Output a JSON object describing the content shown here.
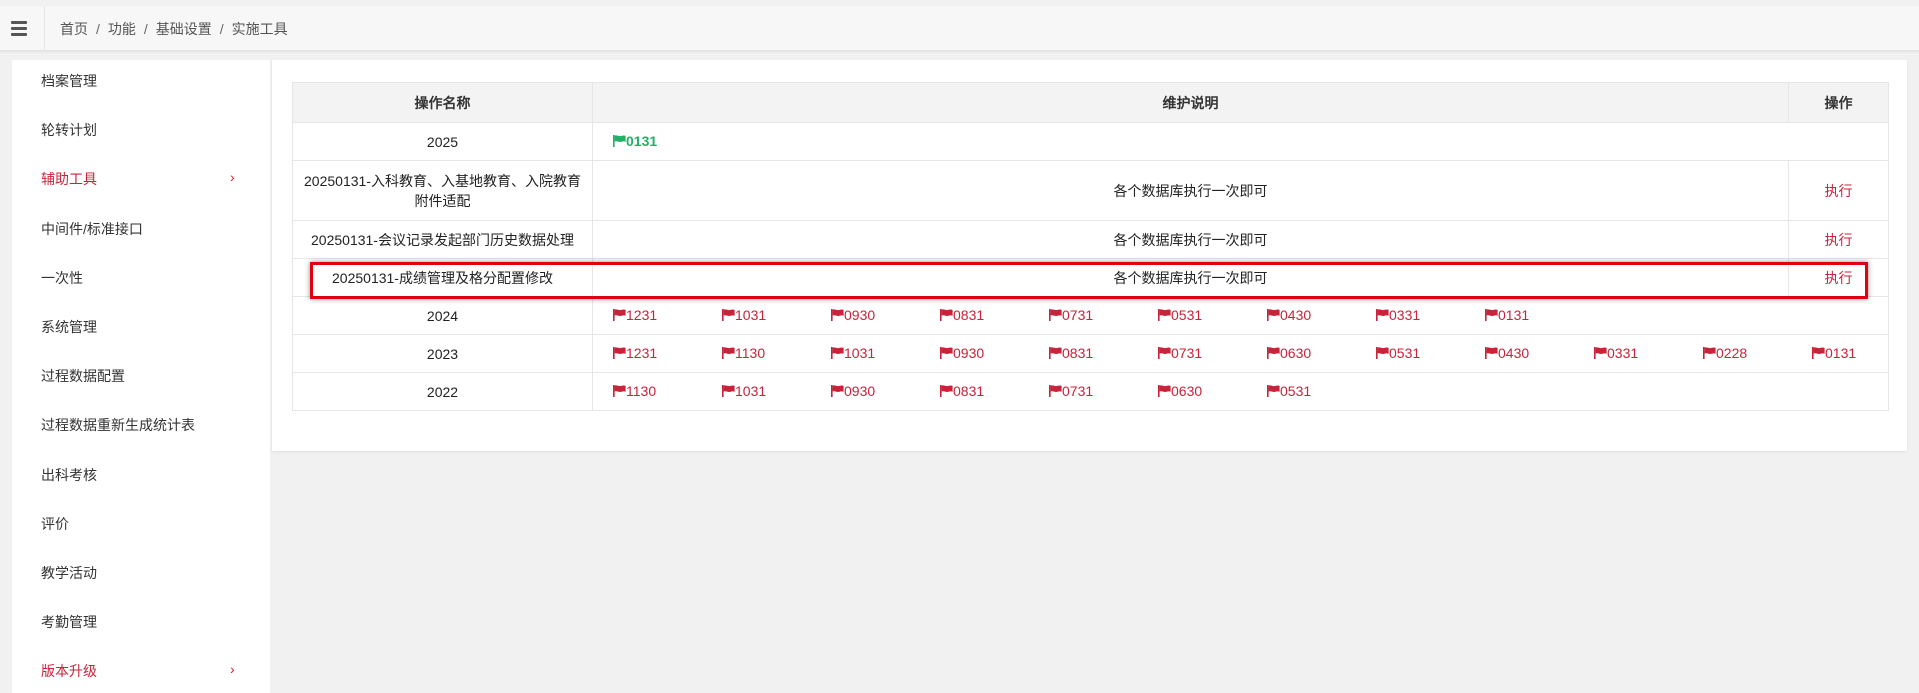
{
  "breadcrumb": [
    {
      "label": "首页",
      "name": "breadcrumb-home"
    },
    {
      "label": "功能",
      "name": "breadcrumb-function"
    },
    {
      "label": "基础设置",
      "name": "breadcrumb-basic-settings"
    },
    {
      "label": "实施工具",
      "name": "breadcrumb-implementation-tools"
    }
  ],
  "sidebar": {
    "items": [
      {
        "label": "档案管理",
        "active": false,
        "expandable": false
      },
      {
        "label": "轮转计划",
        "active": false,
        "expandable": false
      },
      {
        "label": "辅助工具",
        "active": true,
        "expandable": true
      },
      {
        "label": "中间件/标准接口",
        "active": false,
        "expandable": false
      },
      {
        "label": "一次性",
        "active": false,
        "expandable": false
      },
      {
        "label": "系统管理",
        "active": false,
        "expandable": false
      },
      {
        "label": "过程数据配置",
        "active": false,
        "expandable": false
      },
      {
        "label": "过程数据重新生成统计表",
        "active": false,
        "expandable": false
      },
      {
        "label": "出科考核",
        "active": false,
        "expandable": false
      },
      {
        "label": "评价",
        "active": false,
        "expandable": false
      },
      {
        "label": "教学活动",
        "active": false,
        "expandable": false
      },
      {
        "label": "考勤管理",
        "active": false,
        "expandable": false
      },
      {
        "label": "版本升级",
        "active": true,
        "expandable": true
      }
    ],
    "chevron": "›"
  },
  "table": {
    "headers": {
      "name": "操作名称",
      "desc": "维护说明",
      "op": "操作"
    },
    "rows": [
      {
        "type": "year",
        "name": "2025",
        "flags": [
          "0131"
        ],
        "flag_color": "#21b066"
      },
      {
        "type": "op",
        "name_line1": "20250131-入科教育、入基地教育、入院教育",
        "name_line2": "附件适配",
        "desc": "各个数据库执行一次即可",
        "op": "执行"
      },
      {
        "type": "op",
        "name": "20250131-会议记录发起部门历史数据处理",
        "desc": "各个数据库执行一次即可",
        "op": "执行"
      },
      {
        "type": "op",
        "name": "20250131-成绩管理及格分配置修改",
        "desc": "各个数据库执行一次即可",
        "op": "执行"
      },
      {
        "type": "year",
        "name": "2024",
        "flags": [
          "1231",
          "1031",
          "0930",
          "0831",
          "0731",
          "0531",
          "0430",
          "0331",
          "0131"
        ],
        "flag_color": "#c8233a"
      },
      {
        "type": "year",
        "name": "2023",
        "flags": [
          "1231",
          "1130",
          "1031",
          "0930",
          "0831",
          "0731",
          "0630",
          "0531",
          "0430",
          "0331",
          "0228",
          "0131"
        ],
        "flag_color": "#c8233a"
      },
      {
        "type": "year",
        "name": "2022",
        "flags": [
          "1130",
          "1031",
          "0930",
          "0831",
          "0731",
          "0630",
          "0531"
        ],
        "flag_color": "#c8233a"
      }
    ]
  },
  "colors": {
    "accent": "#c8233a",
    "green_flag": "#21b066",
    "highlight": "#e00010"
  },
  "icons": {
    "menu": "hamburger-menu-icon",
    "flag": "flag-icon",
    "chevron": "chevron-right-icon"
  }
}
